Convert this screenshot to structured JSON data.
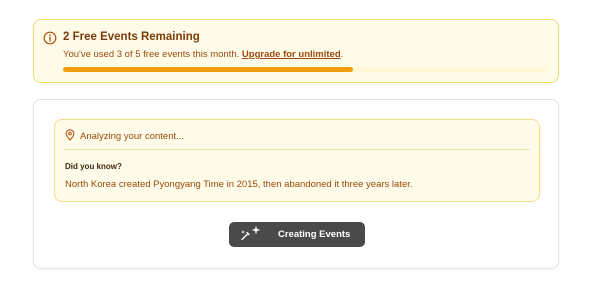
{
  "quota": {
    "title": "2 Free Events Remaining",
    "message": "You've used 3 of 5 free events this month. ",
    "upgrade_link": "Upgrade for unlimited",
    "trailing": ".",
    "used": 3,
    "limit": 5,
    "progress_fraction": 0.6,
    "progress_color": "#f29d0a",
    "icon": "info-circle-icon"
  },
  "analysis": {
    "status": "Analyzing your content...",
    "did_you_know_label": "Did you know?",
    "fact": "North Korea created Pyongyang Time in 2015, then abandoned it three years later.",
    "icon": "map-pin-icon"
  },
  "action": {
    "label": "Creating Events",
    "icon": "magic-wand-icon"
  }
}
